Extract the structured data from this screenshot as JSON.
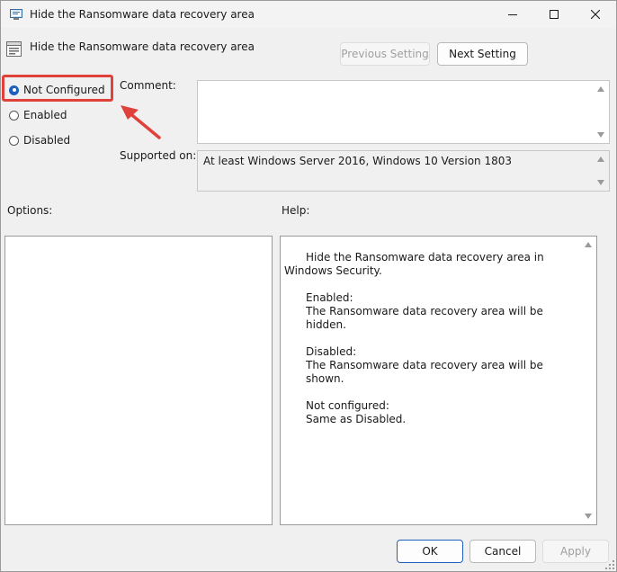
{
  "window": {
    "title": "Hide the Ransomware data recovery area",
    "controls": {
      "minimize": "minimize",
      "maximize": "maximize",
      "close": "close"
    }
  },
  "header": {
    "title": "Hide the Ransomware data recovery area",
    "previous_label": "Previous Setting",
    "next_label": "Next Setting"
  },
  "state": {
    "options": [
      {
        "label": "Not Configured",
        "checked": true
      },
      {
        "label": "Enabled",
        "checked": false
      },
      {
        "label": "Disabled",
        "checked": false
      }
    ]
  },
  "comment": {
    "label": "Comment:",
    "value": ""
  },
  "supported": {
    "label": "Supported on:",
    "value": "At least Windows Server 2016, Windows 10 Version 1803"
  },
  "options_panel": {
    "label": "Options:"
  },
  "help_panel": {
    "label": "Help:",
    "intro": "Hide the Ransomware data recovery area in Windows Security.",
    "enabled_heading": "Enabled:",
    "enabled_text": "The Ransomware data recovery area will be hidden.",
    "disabled_heading": "Disabled:",
    "disabled_text": "The Ransomware data recovery area will be shown.",
    "notconfigured_heading": "Not configured:",
    "notconfigured_text": "Same as Disabled."
  },
  "footer": {
    "ok_label": "OK",
    "cancel_label": "Cancel",
    "apply_label": "Apply"
  },
  "colors": {
    "accent": "#1f5fbf",
    "annotation": "#e0423b"
  },
  "icons": [
    "app-icon",
    "policy-setting-icon",
    "minimize-icon",
    "maximize-icon",
    "close-icon",
    "annotation-arrow-icon"
  ]
}
